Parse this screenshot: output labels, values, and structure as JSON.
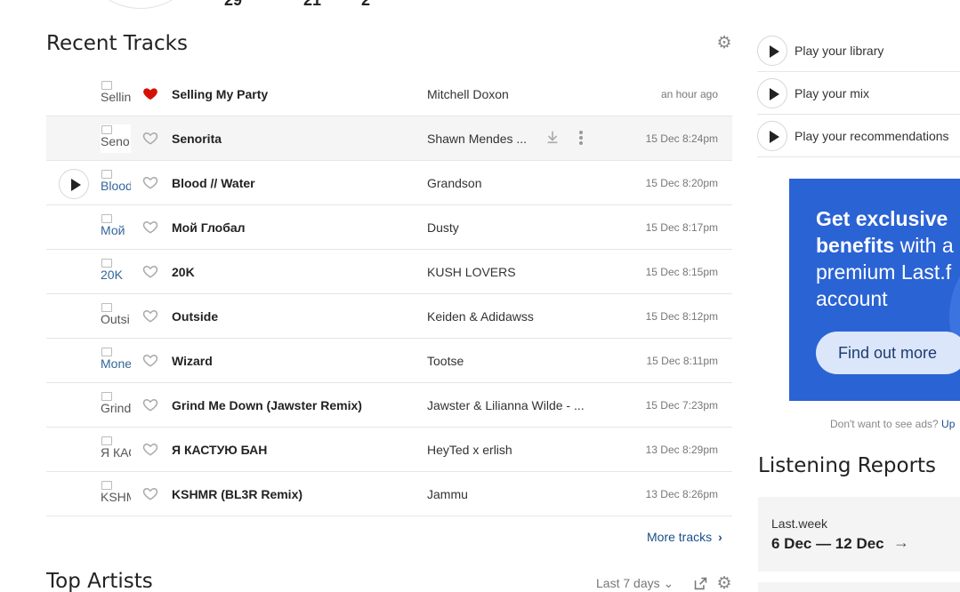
{
  "header": {
    "stats": [
      "29",
      "21",
      "2"
    ]
  },
  "recent_tracks": {
    "title": "Recent Tracks",
    "more_label": "More tracks",
    "tracks": [
      {
        "art_alt": "Sellin",
        "name": "Selling My Party",
        "artist": "Mitchell Doxon",
        "time": "an hour ago",
        "loved": true
      },
      {
        "art_alt": "Seno",
        "name": "Senorita",
        "artist": "Shawn Mendes ...",
        "time": "15 Dec 8:24pm",
        "loved": false
      },
      {
        "art_alt": "Blood",
        "name": "Blood // Water",
        "artist": "Grandson",
        "time": "15 Dec 8:20pm",
        "loved": false
      },
      {
        "art_alt": "Мой",
        "name": "Мой Глобал",
        "artist": "Dusty",
        "time": "15 Dec 8:17pm",
        "loved": false
      },
      {
        "art_alt": "20K",
        "name": "20K",
        "artist": "KUSH LOVERS",
        "time": "15 Dec 8:15pm",
        "loved": false
      },
      {
        "art_alt": "Outsi",
        "name": "Outside",
        "artist": "Keiden & Adidawss",
        "time": "15 Dec 8:12pm",
        "loved": false
      },
      {
        "art_alt": "Mone",
        "name": "Wizard",
        "artist": "Tootse",
        "time": "15 Dec 8:11pm",
        "loved": false
      },
      {
        "art_alt": "Grind",
        "name": "Grind Me Down (Jawster Remix)",
        "artist": "Jawster & Lilianna Wilde - ...",
        "time": "15 Dec 7:23pm",
        "loved": false
      },
      {
        "art_alt": "Я КАСТ",
        "name": "Я КАСТУЮ БАН",
        "artist": "HeyTed x erlish",
        "time": "13 Dec 8:29pm",
        "loved": false
      },
      {
        "art_alt": "KSHM",
        "name": "KSHMR (BL3R Remix)",
        "artist": "Jammu",
        "time": "13 Dec 8:26pm",
        "loved": false
      }
    ]
  },
  "top_artists": {
    "title": "Top Artists",
    "period": "Last 7 days"
  },
  "play_options": [
    "Play your library",
    "Play your mix",
    "Play your recommendations"
  ],
  "ad": {
    "line1": "Get exclusive",
    "line2_bold": "benefits",
    "line2_rest": " with a",
    "line3": "premium Last.f",
    "line4": "account",
    "button": "Find out more",
    "note": "Don't want to see ads? ",
    "note_link": "Up"
  },
  "listening_reports": {
    "title": "Listening Reports",
    "label": "Last.week",
    "range": "6 Dec — 12 Dec"
  },
  "colors": {
    "accent_blue": "#2a63d4",
    "link": "#1a4e8c",
    "heart_loved": "#d51007"
  }
}
